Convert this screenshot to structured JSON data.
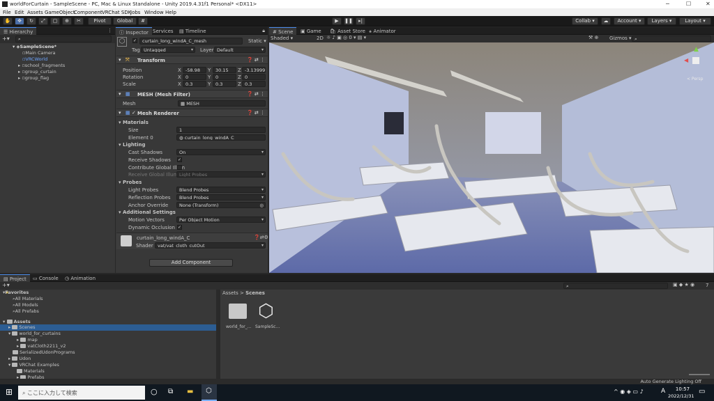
{
  "title": "worldForCurtain - SampleScene - PC, Mac & Linux Standalone - Unity 2019.4.31f1 Personal* <DX11>",
  "menu": [
    "File",
    "Edit",
    "Assets",
    "GameObject",
    "Component",
    "VRChat SDK",
    "Jobs",
    "Window",
    "Help"
  ],
  "toolbar": {
    "pivot": "Pivot",
    "global": "Global",
    "collab": "Collab ▾",
    "account": "Account",
    "layers": "Layers",
    "layout": "Layout"
  },
  "hierarchy": {
    "tab": "Hierarchy",
    "scene": "SampleScene*",
    "items": [
      "Main Camera",
      "VRCWorld",
      "school_fragments",
      "group_curtain",
      "group_flag"
    ]
  },
  "inspector": {
    "tabs": [
      "Inspector",
      "Services",
      "Timeline"
    ],
    "object_name": "curtain_long_windA_C_mesh",
    "static": "Static ▾",
    "tag_label": "Tag",
    "tag": "Untagged",
    "layer_label": "Layer",
    "layer": "Default",
    "transform": {
      "title": "Transform",
      "position": "Position",
      "rotation": "Rotation",
      "scale": "Scale",
      "x": "X",
      "y": "Y",
      "z": "Z",
      "pos": [
        "-58.98",
        "30.15",
        "-3.139999"
      ],
      "rot": [
        "0",
        "0",
        "0"
      ],
      "scl": [
        "0.3",
        "0.3",
        "0.3"
      ]
    },
    "meshfilter": {
      "title": "MESH (Mesh Filter)",
      "mesh_label": "Mesh",
      "mesh": "MESH"
    },
    "renderer": {
      "title": "Mesh Renderer",
      "materials": "Materials",
      "size_label": "Size",
      "size": "1",
      "element_label": "Element 0",
      "element": "curtain_long_windA_C",
      "lighting": "Lighting",
      "cast_label": "Cast Shadows",
      "cast": "On",
      "receive_label": "Receive Shadows",
      "contrib_label": "Contribute Global Illum",
      "rgi_label": "Receive Global Illumi",
      "rgi": "Light Probes",
      "probes": "Probes",
      "lp_label": "Light Probes",
      "lp": "Blend Probes",
      "rp_label": "Reflection Probes",
      "rp": "Blend Probes",
      "ao_label": "Anchor Override",
      "ao": "None (Transform)",
      "additional": "Additional Settings",
      "mv_label": "Motion Vectors",
      "mv": "Per Object Motion",
      "do_label": "Dynamic Occlusion"
    },
    "material": {
      "name": "curtain_long_windA_C",
      "shader_label": "Shader",
      "shader": "vat/vat_cloth_cutOut"
    },
    "add_component": "Add Component"
  },
  "scene": {
    "tabs": [
      "Scene",
      "Game",
      "Asset Store",
      "Animator"
    ],
    "shaded": "Shaded",
    "twod": "2D",
    "gizmos": "Gizmos ▾",
    "persp": "< Persp"
  },
  "project": {
    "tabs": [
      "Project",
      "Console",
      "Animation"
    ],
    "breadcrumb_root": "Assets",
    "breadcrumb_leaf": "Scenes",
    "favorites": "Favorites",
    "fav_items": [
      "All Materials",
      "All Models",
      "All Prefabs"
    ],
    "assets": "Assets",
    "tree": [
      "Scenes",
      "world_for_curtains",
      "map",
      "vatCloth2211_v2",
      "SerializedUdonPrograms",
      "Udon",
      "VRChat Examples",
      "Materials",
      "Prefabs"
    ],
    "files": [
      "world_for_...",
      "SampleSc..."
    ],
    "count": "7"
  },
  "status": {
    "lighting": "Auto Generate Lighting Off"
  },
  "taskbar": {
    "search": "ここに入力して検索",
    "time": "10:57",
    "date": "2022/12/31",
    "lang": "A"
  }
}
